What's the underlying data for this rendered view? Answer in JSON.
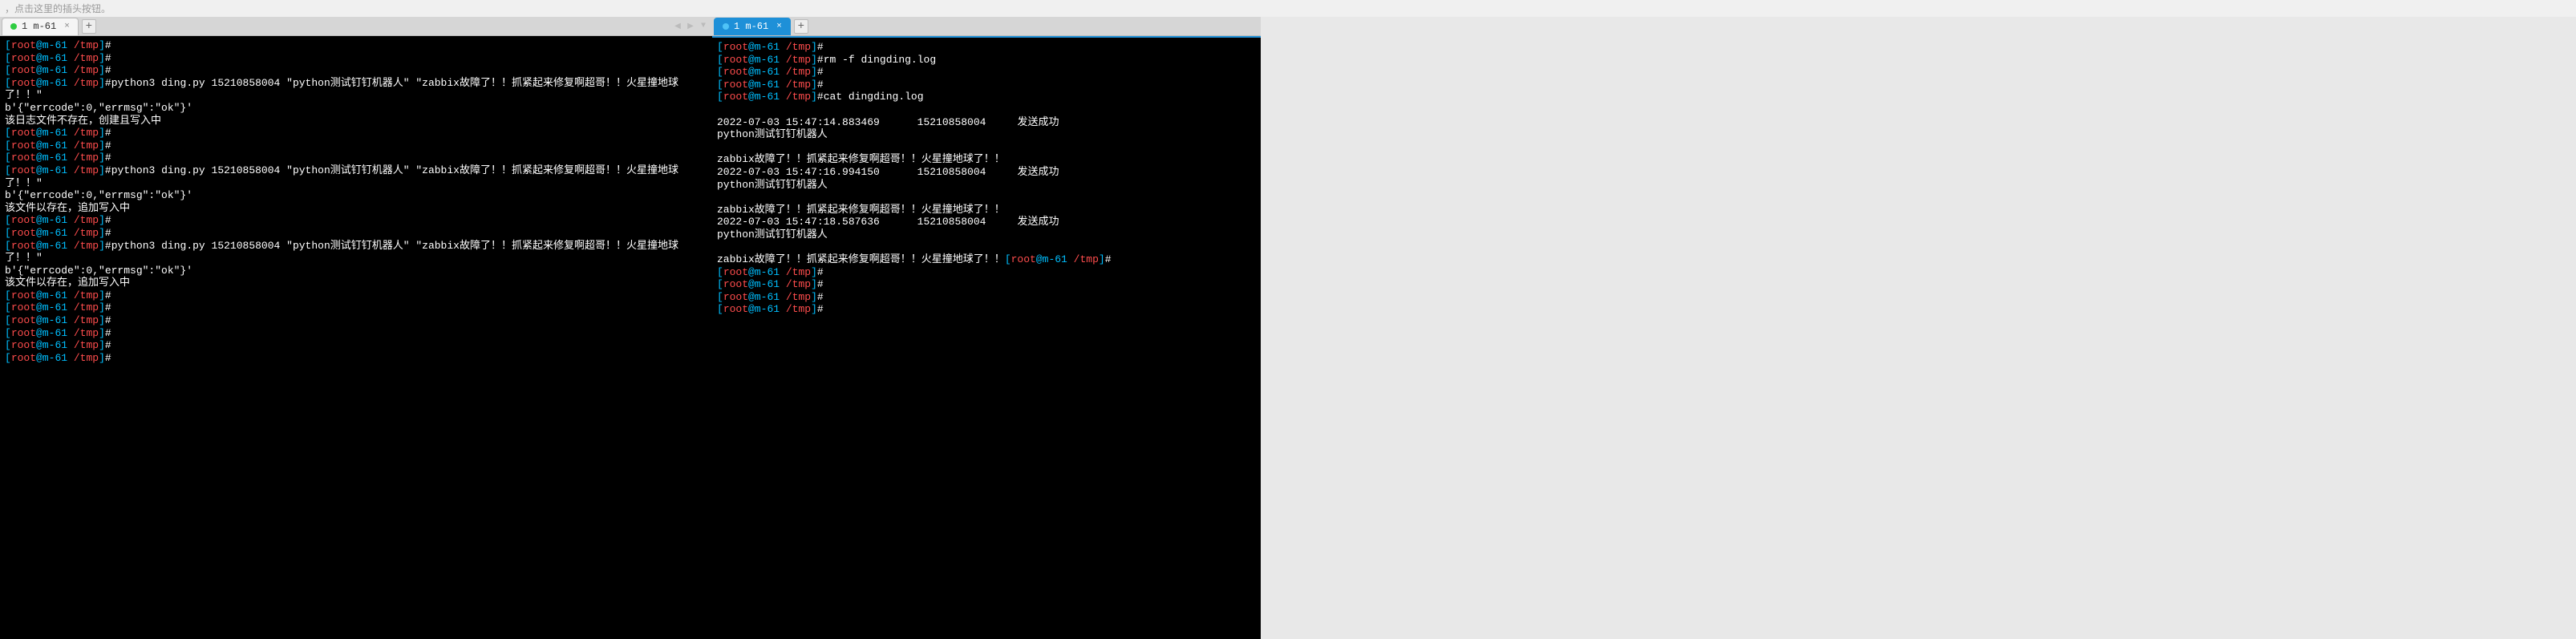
{
  "top_hint": "，点击这里的插头按钮。",
  "tabs": {
    "left": {
      "label": "1 m-61",
      "close": "×"
    },
    "right": {
      "label": "1 m-61",
      "close": "×"
    },
    "add": "+"
  },
  "prompt": {
    "lbracket": "[",
    "user": "root",
    "at": "@",
    "host": "m-61",
    "path": " /tmp",
    "rbracket": "]",
    "hash": "#"
  },
  "left_lines": [
    {
      "type": "prompt",
      "cmd": ""
    },
    {
      "type": "prompt",
      "cmd": ""
    },
    {
      "type": "prompt",
      "cmd": ""
    },
    {
      "type": "prompt",
      "cmd": "python3 ding.py 15210858004 \"python测试钉钉机器人\" \"zabbix故障了！！抓紧起来修复啊超哥！！火星撞地球了！！\""
    },
    {
      "type": "text",
      "text": "b'{\"errcode\":0,\"errmsg\":\"ok\"}'"
    },
    {
      "type": "text",
      "text": "该日志文件不存在，创建且写入中"
    },
    {
      "type": "prompt",
      "cmd": ""
    },
    {
      "type": "prompt",
      "cmd": ""
    },
    {
      "type": "prompt",
      "cmd": ""
    },
    {
      "type": "prompt",
      "cmd": "python3 ding.py 15210858004 \"python测试钉钉机器人\" \"zabbix故障了！！抓紧起来修复啊超哥！！火星撞地球了！！\""
    },
    {
      "type": "text",
      "text": "b'{\"errcode\":0,\"errmsg\":\"ok\"}'"
    },
    {
      "type": "text",
      "text": "该文件以存在，追加写入中"
    },
    {
      "type": "prompt",
      "cmd": ""
    },
    {
      "type": "prompt",
      "cmd": ""
    },
    {
      "type": "prompt",
      "cmd": "python3 ding.py 15210858004 \"python测试钉钉机器人\" \"zabbix故障了！！抓紧起来修复啊超哥！！火星撞地球了！！\""
    },
    {
      "type": "text",
      "text": "b'{\"errcode\":0,\"errmsg\":\"ok\"}'"
    },
    {
      "type": "text",
      "text": "该文件以存在，追加写入中"
    },
    {
      "type": "prompt",
      "cmd": ""
    },
    {
      "type": "prompt",
      "cmd": ""
    },
    {
      "type": "prompt",
      "cmd": ""
    },
    {
      "type": "prompt",
      "cmd": ""
    },
    {
      "type": "prompt",
      "cmd": ""
    },
    {
      "type": "prompt",
      "cmd": ""
    }
  ],
  "right_lines": [
    {
      "type": "prompt",
      "cmd": ""
    },
    {
      "type": "prompt",
      "cmd": "rm -f dingding.log"
    },
    {
      "type": "prompt",
      "cmd": ""
    },
    {
      "type": "prompt",
      "cmd": ""
    },
    {
      "type": "prompt",
      "cmd": "cat dingding.log"
    },
    {
      "type": "blank"
    },
    {
      "type": "text",
      "text": "2022-07-03 15:47:14.883469      15210858004     发送成功"
    },
    {
      "type": "text",
      "text": "python测试钉钉机器人"
    },
    {
      "type": "blank"
    },
    {
      "type": "text",
      "text": "zabbix故障了！！抓紧起来修复啊超哥！！火星撞地球了！！"
    },
    {
      "type": "text",
      "text": "2022-07-03 15:47:16.994150      15210858004     发送成功"
    },
    {
      "type": "text",
      "text": "python测试钉钉机器人"
    },
    {
      "type": "blank"
    },
    {
      "type": "text",
      "text": "zabbix故障了！！抓紧起来修复啊超哥！！火星撞地球了！！"
    },
    {
      "type": "text",
      "text": "2022-07-03 15:47:18.587636      15210858004     发送成功"
    },
    {
      "type": "text",
      "text": "python测试钉钉机器人"
    },
    {
      "type": "blank"
    },
    {
      "type": "text_prompt",
      "text": "zabbix故障了！！抓紧起来修复啊超哥！！火星撞地球了！！",
      "cmd": ""
    },
    {
      "type": "prompt",
      "cmd": ""
    },
    {
      "type": "prompt",
      "cmd": ""
    },
    {
      "type": "prompt",
      "cmd": ""
    },
    {
      "type": "prompt",
      "cmd": ""
    }
  ]
}
